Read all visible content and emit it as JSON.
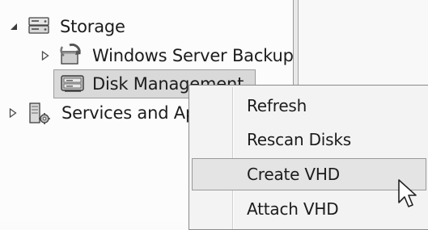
{
  "tree": {
    "items": [
      {
        "label": "Storage",
        "expander": "expanded",
        "icon": "storage-icon"
      },
      {
        "label": "Windows Server Backup",
        "expander": "collapsed",
        "icon": "backup-icon"
      },
      {
        "label": "Disk Management",
        "expander": "none",
        "icon": "disk-management-icon"
      },
      {
        "label": "Services and Applications",
        "expander": "collapsed",
        "icon": "services-icon"
      }
    ]
  },
  "context_menu": {
    "items": [
      {
        "label": "Refresh"
      },
      {
        "label": "Rescan Disks"
      },
      {
        "label": "Create VHD",
        "highlighted": true
      },
      {
        "label": "Attach VHD"
      }
    ]
  },
  "colors": {
    "selection": "#d9d9d9",
    "menu_background": "#f3f3f3",
    "menu_hover": "#e4e4e4"
  }
}
